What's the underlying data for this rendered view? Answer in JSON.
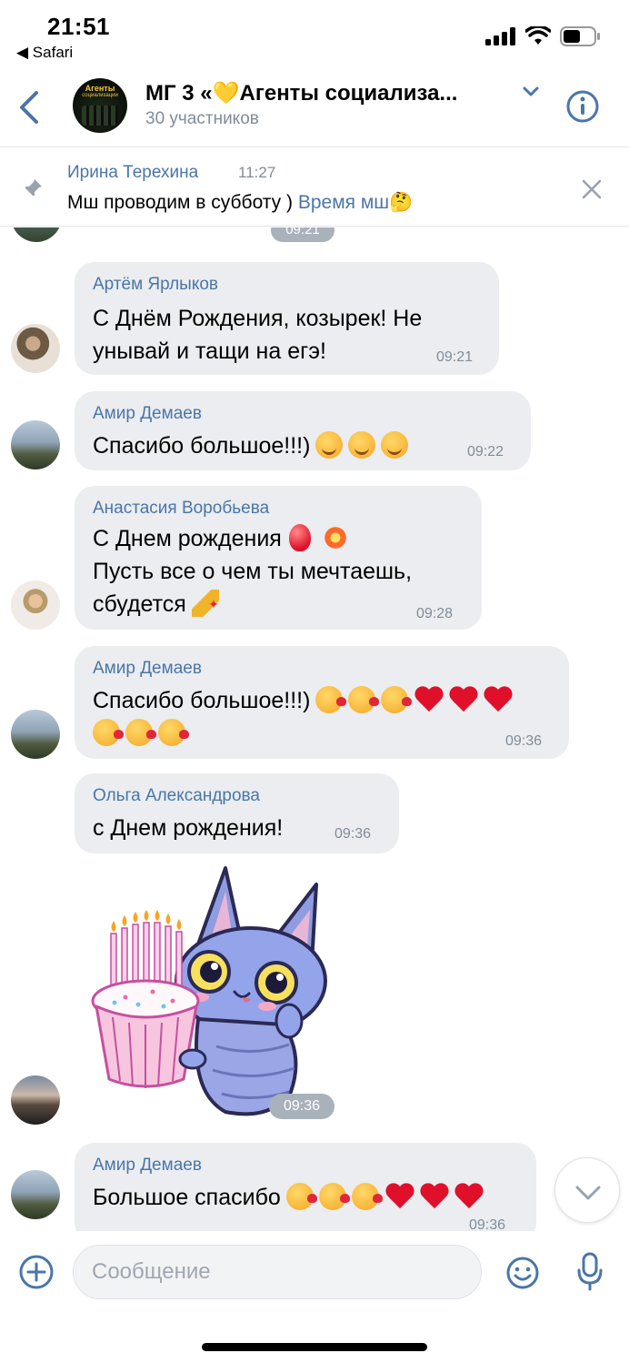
{
  "status_bar": {
    "time": "21:51",
    "back_app": "Safari"
  },
  "header": {
    "title": "МГ 3 «💛Агенты социализа...",
    "subtitle": "30 участников",
    "avatar_text": "Агенты",
    "avatar_subtext": "социализации"
  },
  "pinned": {
    "author": "Ирина Терехина",
    "time": "11:27",
    "text": "Мш проводим в субботу )",
    "link": "Время мш🤔"
  },
  "partial": {
    "time": "09:21"
  },
  "messages": [
    {
      "author": "Артём Ярлыков",
      "lines": [
        "С Днём Рождения, козырек! Не",
        "унывай и тащи на егэ!"
      ],
      "time": "09:21"
    },
    {
      "author": "Амир Демаев",
      "lines": [
        "Спасибо большое!!!)"
      ],
      "time": "09:22"
    },
    {
      "author": "Анастасия Воробьева",
      "lines": [
        "С Днем рождения",
        "Пусть все о чем ты мечтаешь,",
        "сбудется"
      ],
      "time": "09:28"
    },
    {
      "author": "Амир Демаев",
      "lines": [
        "Спасибо большое!!!)"
      ],
      "time": "09:36"
    },
    {
      "author": "Ольга Александрова",
      "lines": [
        "с Днем рождения!"
      ],
      "time": "09:36"
    },
    {
      "sticker_time": "09:36"
    },
    {
      "author": "Амир Демаев",
      "lines": [
        "Большое спасибо"
      ],
      "time": "09:36"
    }
  ],
  "composer": {
    "placeholder": "Сообщение"
  },
  "colors": {
    "accent": "#4a76a8",
    "bubble": "#ebedf0",
    "meta": "#818c99"
  }
}
